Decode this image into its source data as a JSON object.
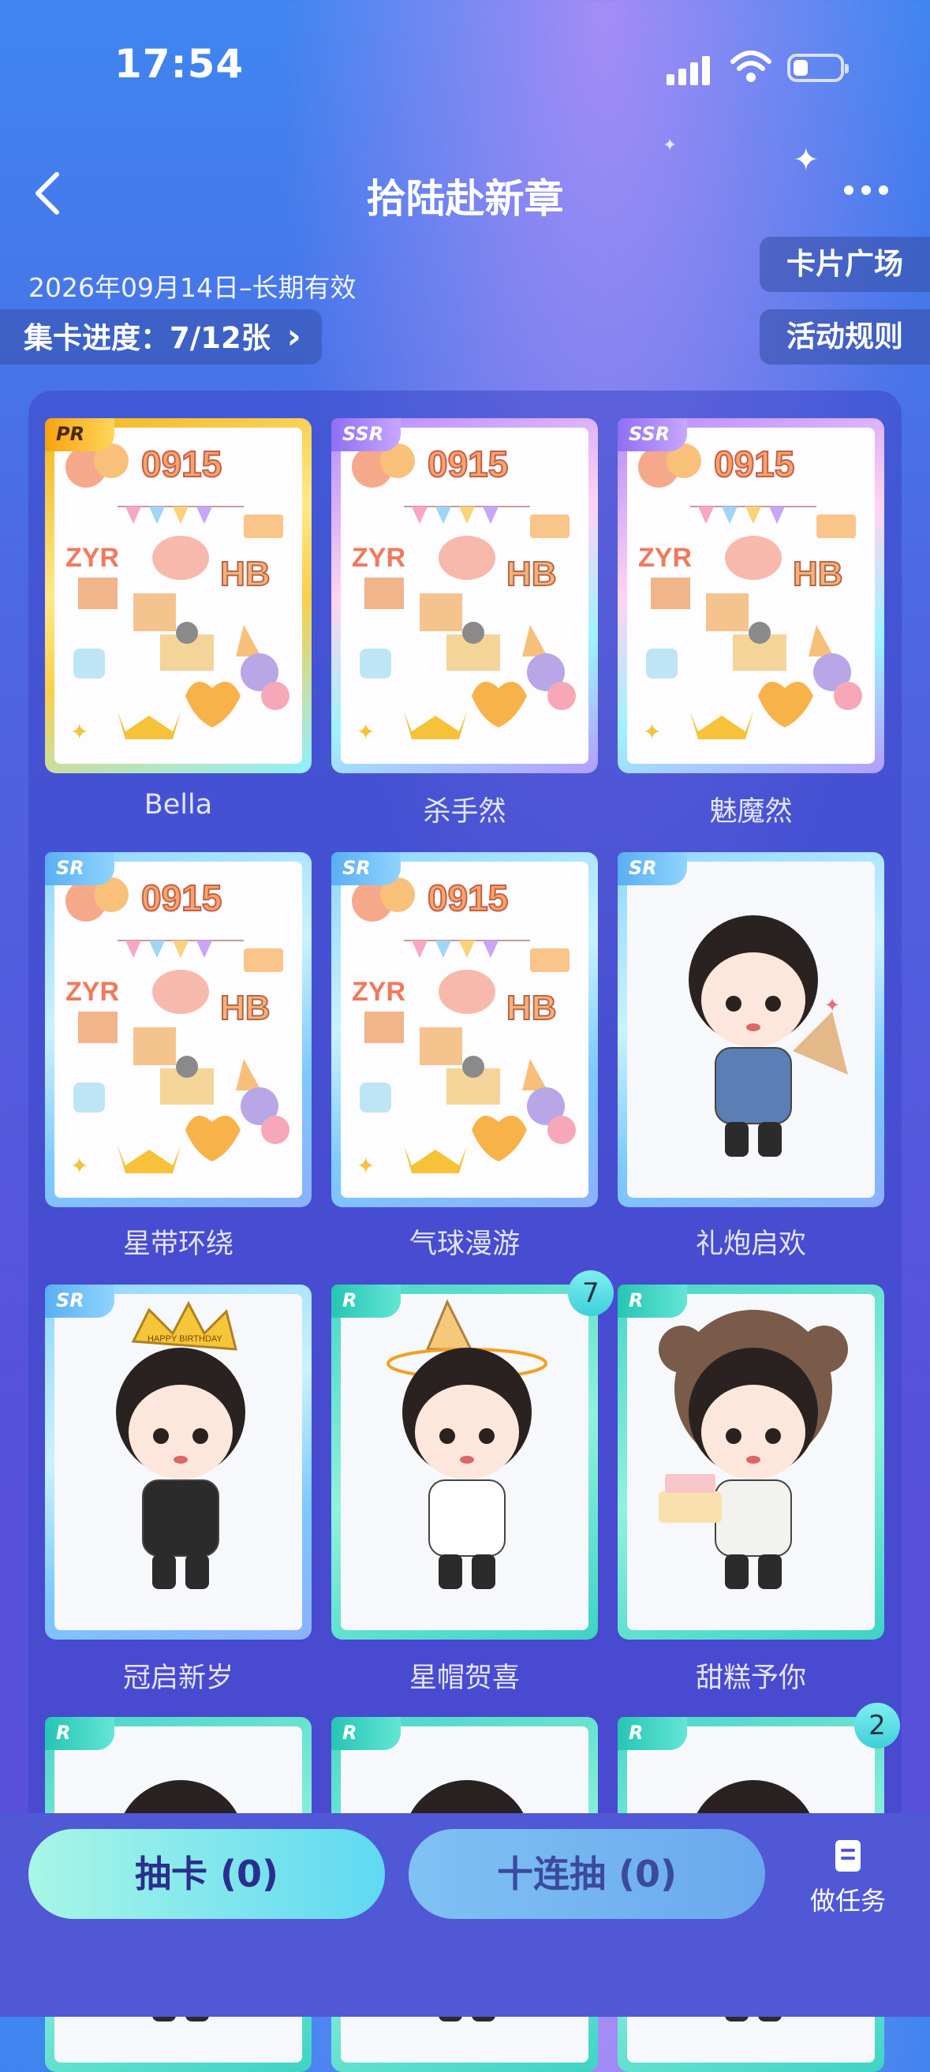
{
  "status": {
    "time": "17:54"
  },
  "nav": {
    "title": "拾陆赴新章"
  },
  "info": {
    "validity": "2026年09月14日–长期有效",
    "progress": "集卡进度：7/12张",
    "progress_chevron": "›",
    "card_plaza": "卡片广场",
    "rules": "活动规则"
  },
  "cards": [
    {
      "rarity": "PR",
      "name": "Bella"
    },
    {
      "rarity": "SSR",
      "name": "杀手然"
    },
    {
      "rarity": "SSR",
      "name": "魅魔然"
    },
    {
      "rarity": "SR",
      "name": "星带环绕"
    },
    {
      "rarity": "SR",
      "name": "气球漫游"
    },
    {
      "rarity": "SR",
      "name": "礼炮启欢"
    },
    {
      "rarity": "SR",
      "name": "冠启新岁"
    },
    {
      "rarity": "R",
      "name": "星帽贺喜",
      "count": "7"
    },
    {
      "rarity": "R",
      "name": "甜糕予你"
    },
    {
      "rarity": "R"
    },
    {
      "rarity": "R"
    },
    {
      "rarity": "R",
      "count": "2"
    }
  ],
  "sticker_text": {
    "num": "0915",
    "initials": "ZYR",
    "hb": "HB",
    "crown": "HAPPY BIRTHDAY"
  },
  "bottom": {
    "draw_one": "抽卡 (0)",
    "draw_ten": "十连抽 (0)",
    "task": "做任务"
  },
  "colors": {
    "accent": "#5fd9f2",
    "panel": "#4046c8"
  }
}
